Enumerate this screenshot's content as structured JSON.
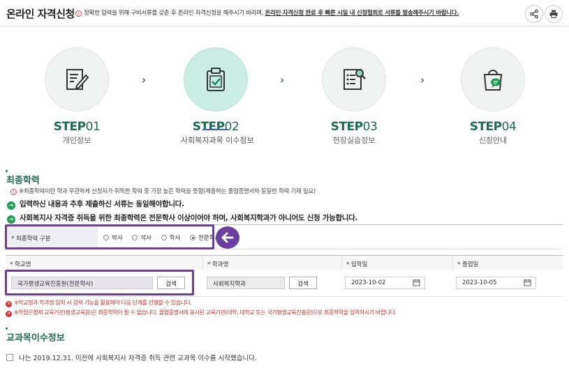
{
  "header": {
    "title": "온라인 자격신청",
    "notice_prefix": "정확한 입력을 위해 구비서류를 갖춘 후 온라인 자격신청을 해주시기 바라며, ",
    "notice_emphasis": "온라인 자격신청 완료 후 빠른 시일 내 신청협회로 서류를 발송해주시기 바랍니다."
  },
  "steps": [
    {
      "label": "STEP",
      "num": "01",
      "sub": "개인정보",
      "icon": "pencil-document-icon"
    },
    {
      "label": "STEP",
      "num": "02",
      "sub": "사회복지과목 이수정보",
      "icon": "clipboard-check-icon"
    },
    {
      "label": "STEP",
      "num": "03",
      "sub": "현장실습정보",
      "icon": "document-search-icon"
    },
    {
      "label": "STEP",
      "num": "04",
      "sub": "신청안내",
      "icon": "shopping-bag-icon"
    }
  ],
  "education": {
    "heading": "최종학력",
    "note": "※최종학력이란 학과 무관하게 신청자가 취득한 학력 중 가장 높은 학력을 뜻함(제출하는 졸업증명서와 동일한 학력 기재 필요)",
    "bullet1": "입력하신 내용과 추후 제출하신 서류는 동일해야합니다.",
    "bullet2": "사회복지사 자격증 취득을 위한 최종학력은 전문학사 이상이어야 하며, 사회복지학과가 아니어도 신청 가능합니다.",
    "degree_label": "* 최종학력 구분",
    "degree_options": [
      "박사",
      "석사",
      "학사",
      "전문학사"
    ],
    "selected_degree": "전문학사"
  },
  "school_table": {
    "col_school": "* 학교명",
    "col_major": "* 학과명",
    "col_admission": "* 입학일",
    "col_graduation": "* 졸업일",
    "school_value": "국가평생교육진흥원(전문학사)",
    "major_value": "사회복지학과",
    "admission_value": "2023-10-02",
    "graduation_value": "2023-10-05",
    "search_label": "검색"
  },
  "warnings": {
    "w1": "※학교명과 학과명 입력 시 검색 기능을 활용해야 다음 단계를 진행할 수 있습니다.",
    "w2": "※학점은행제 교육기관(평생교육원)은 최종학력이 될 수 없습니다. 졸업증명서에 표시된 교육기관(대학, 대학교 또는 국가평생교육진흥원)으로 최종학력을 입력하시기 바랍니다."
  },
  "courses": {
    "heading": "교과목이수정보",
    "checkbox_label": "나는 2019.12.31. 이전에 사회복지사 자격증 취득 관련 교과목 이수를 시작했습니다."
  }
}
